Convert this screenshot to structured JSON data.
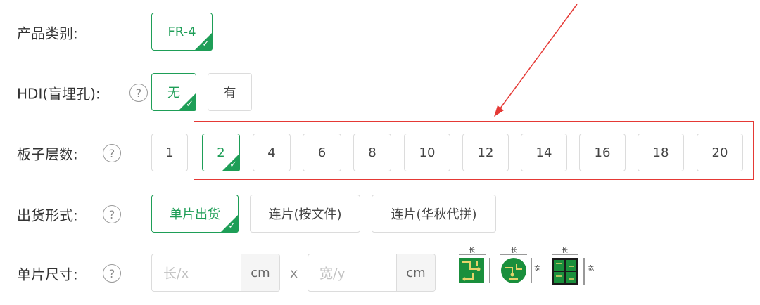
{
  "product_type": {
    "label": "产品类别:",
    "options": [
      {
        "text": "FR-4",
        "selected": true
      }
    ]
  },
  "hdi": {
    "label": "HDI(盲埋孔):",
    "help": "?",
    "options": [
      {
        "text": "无",
        "selected": true
      },
      {
        "text": "有",
        "selected": false
      }
    ]
  },
  "layers": {
    "label": "板子层数:",
    "help": "?",
    "options": [
      {
        "text": "1",
        "selected": false
      },
      {
        "text": "2",
        "selected": true
      },
      {
        "text": "4",
        "selected": false
      },
      {
        "text": "6",
        "selected": false
      },
      {
        "text": "8",
        "selected": false
      },
      {
        "text": "10",
        "selected": false
      },
      {
        "text": "12",
        "selected": false
      },
      {
        "text": "14",
        "selected": false
      },
      {
        "text": "16",
        "selected": false
      },
      {
        "text": "18",
        "selected": false
      },
      {
        "text": "20",
        "selected": false
      }
    ]
  },
  "shipping": {
    "label": "出货形式:",
    "help": "?",
    "options": [
      {
        "text": "单片出货",
        "selected": true
      },
      {
        "text": "连片(按文件)",
        "selected": false
      },
      {
        "text": "连片(华秋代拼)",
        "selected": false
      }
    ]
  },
  "size": {
    "label": "单片尺寸:",
    "help": "?",
    "length_placeholder": "长/x",
    "width_placeholder": "宽/y",
    "unit": "cm",
    "times": "x",
    "diagram_labels": {
      "length": "长",
      "width": "宽"
    }
  },
  "colors": {
    "accent": "#1e9e57",
    "annotation": "#e53935"
  }
}
